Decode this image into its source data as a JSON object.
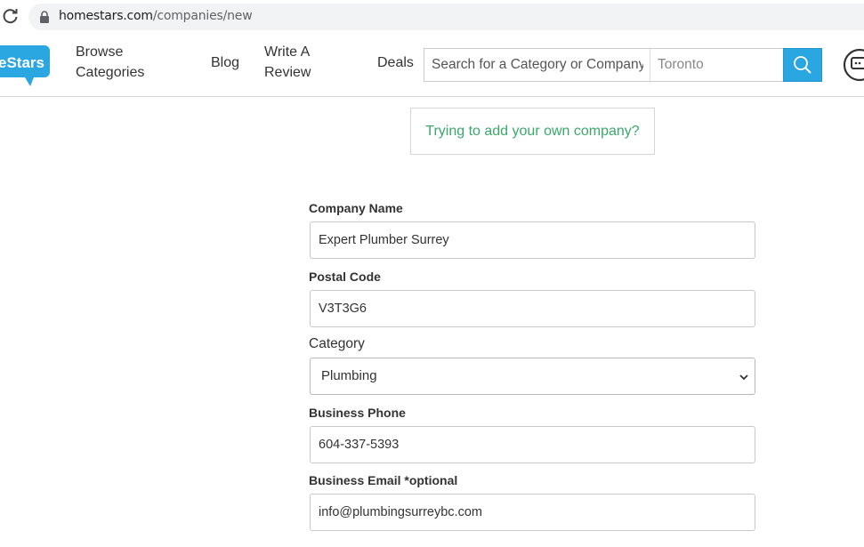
{
  "browser": {
    "url_domain": "homestars.com",
    "url_path": "/companies/new"
  },
  "header": {
    "logo_text": "eStars",
    "nav": {
      "browse_line1": "Browse",
      "browse_line2": "Categories",
      "blog": "Blog",
      "write_line1": "Write A",
      "write_line2": "Review",
      "deals": "Deals"
    },
    "search": {
      "placeholder": "Search for a Category or Company",
      "location_placeholder": "Toronto"
    },
    "colors": {
      "accent": "#2aa6e0",
      "link_green": "#3aa86b"
    }
  },
  "own_company_link": "Trying to add your own company?",
  "form": {
    "company_name": {
      "label": "Company Name",
      "value": "Expert Plumber Surrey"
    },
    "postal_code": {
      "label": "Postal Code",
      "value": "V3T3G6"
    },
    "category": {
      "label": "Category",
      "value": "Plumbing"
    },
    "business_phone": {
      "label": "Business Phone",
      "value": "604-337-5393"
    },
    "business_email": {
      "label": "Business Email *optional",
      "value": "info@plumbingsurreybc.com"
    }
  }
}
